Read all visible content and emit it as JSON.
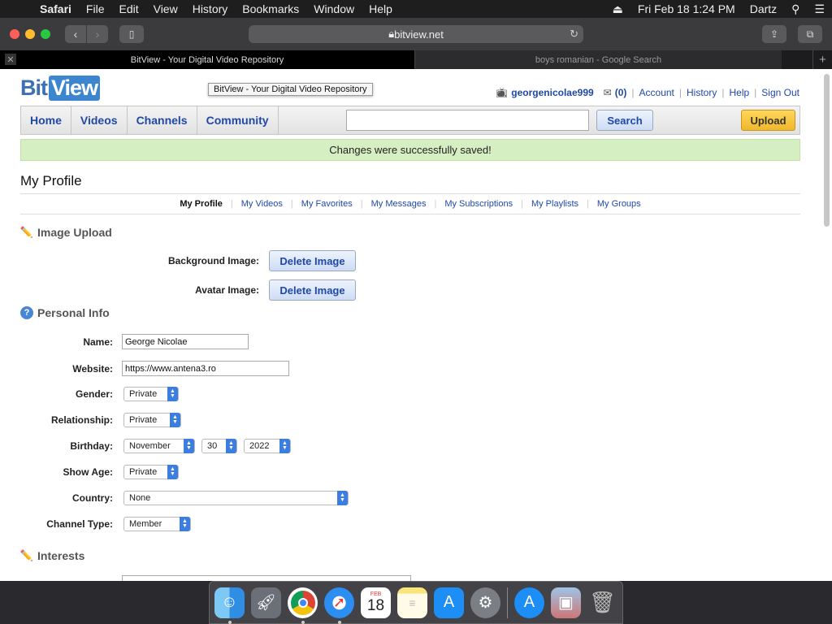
{
  "menubar": {
    "app": "Safari",
    "items": [
      "File",
      "Edit",
      "View",
      "History",
      "Bookmarks",
      "Window",
      "Help"
    ],
    "datetime": "Fri Feb 18  1:24 PM",
    "user": "Dartz"
  },
  "browser": {
    "url": "bitview.net",
    "tabs": [
      {
        "title": "BitView - Your Digital Video Repository",
        "active": true
      },
      {
        "title": "boys romanian - Google Search",
        "active": false
      }
    ],
    "tooltip": "BitView - Your Digital Video Repository"
  },
  "site": {
    "logo_bit": "Bit",
    "logo_view": "View",
    "username": "georgenicolae999",
    "mail_count": "(0)",
    "links": [
      "Account",
      "History",
      "Help",
      "Sign Out"
    ],
    "nav": [
      "Home",
      "Videos",
      "Channels",
      "Community"
    ],
    "search_value": "",
    "search_label": "Search",
    "upload_label": "Upload",
    "success_message": "Changes were successfully saved!"
  },
  "profile": {
    "title": "My Profile",
    "subnav": [
      "My Profile",
      "My Videos",
      "My Favorites",
      "My Messages",
      "My Subscriptions",
      "My Playlists",
      "My Groups"
    ],
    "image_upload": {
      "heading": "Image Upload",
      "background_label": "Background Image:",
      "avatar_label": "Avatar Image:",
      "delete_label": "Delete Image"
    },
    "personal": {
      "heading": "Personal Info",
      "name_label": "Name:",
      "name_value": "George Nicolae",
      "website_label": "Website:",
      "website_value": "https://www.antena3.ro",
      "gender_label": "Gender:",
      "gender_value": "Private",
      "relationship_label": "Relationship:",
      "relationship_value": "Private",
      "birthday_label": "Birthday:",
      "birthday_month": "November",
      "birthday_day": "30",
      "birthday_year": "2022",
      "showage_label": "Show Age:",
      "showage_value": "Private",
      "country_label": "Country:",
      "country_value": "None",
      "channeltype_label": "Channel Type:",
      "channeltype_value": "Member"
    },
    "interests_heading": "Interests"
  },
  "dock": [
    "finder-icon",
    "launchpad-icon",
    "chrome-icon",
    "safari-icon",
    "calendar-icon",
    "notes-icon",
    "app-store-icon",
    "system-preferences-icon",
    "app-store-downloads-icon",
    "photos-icon",
    "trash-icon"
  ],
  "calendar_date": "18",
  "calendar_month": "FEB"
}
